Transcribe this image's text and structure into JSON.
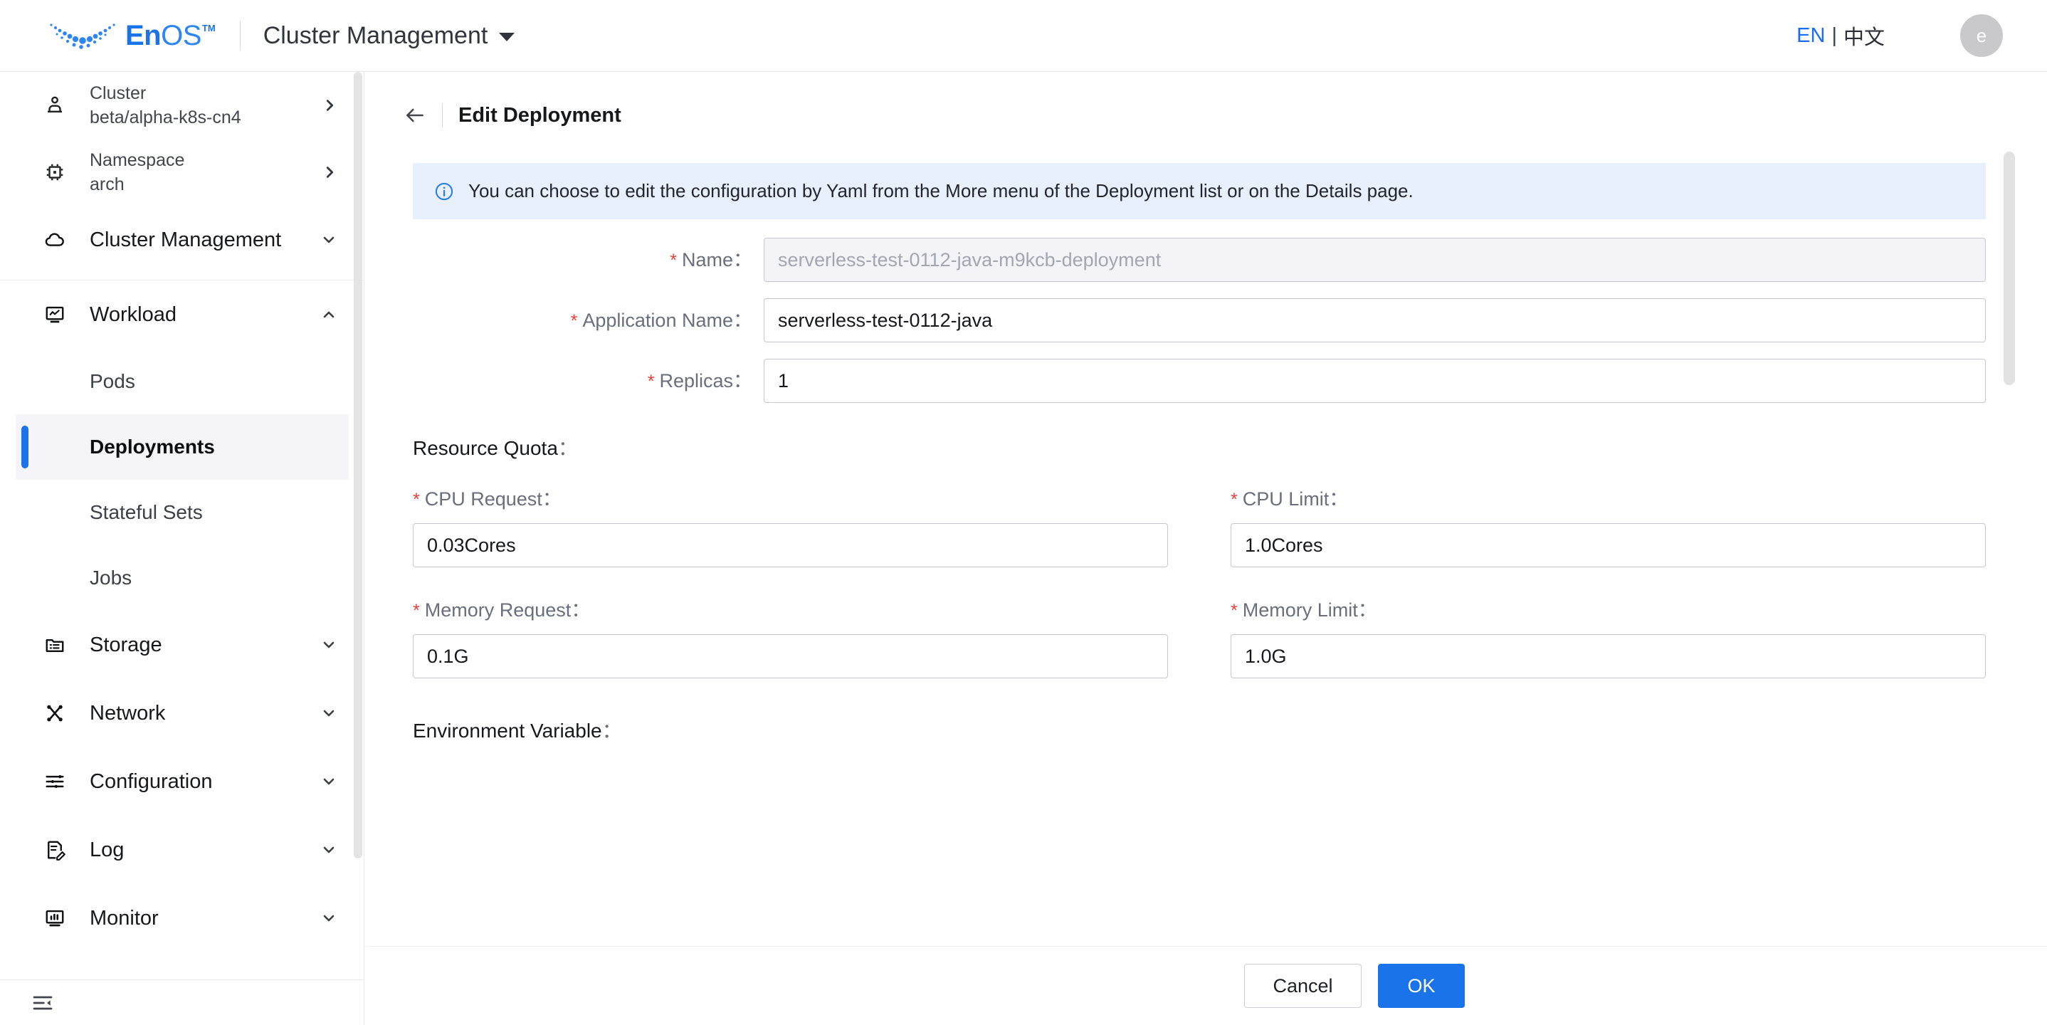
{
  "topbar": {
    "logo_en": "En",
    "logo_os": "OS",
    "logo_tm": "TM",
    "app_title": "Cluster Management",
    "lang_en": "EN",
    "lang_separator": "|",
    "lang_zh": "中文",
    "avatar_initial": "e"
  },
  "sidebar": {
    "context": [
      {
        "label": "Cluster",
        "value": "beta/alpha-k8s-cn4",
        "icon": "user-cluster-icon"
      },
      {
        "label": "Namespace",
        "value": "arch",
        "icon": "namespace-chip-icon"
      }
    ],
    "groups": [
      {
        "label": "Cluster Management",
        "icon": "cloud-icon",
        "state": "collapsed"
      },
      {
        "label": "Workload",
        "icon": "workload-monitor-icon",
        "state": "expanded"
      },
      {
        "label": "Storage",
        "icon": "storage-folder-icon",
        "state": "collapsed"
      },
      {
        "label": "Network",
        "icon": "network-nodes-icon",
        "state": "collapsed"
      },
      {
        "label": "Configuration",
        "icon": "sliders-icon",
        "state": "collapsed"
      },
      {
        "label": "Log",
        "icon": "log-edit-icon",
        "state": "collapsed"
      },
      {
        "label": "Monitor",
        "icon": "monitor-chart-icon",
        "state": "collapsed"
      }
    ],
    "workload_items": [
      {
        "label": "Pods",
        "active": false
      },
      {
        "label": "Deployments",
        "active": true
      },
      {
        "label": "Stateful Sets",
        "active": false
      },
      {
        "label": "Jobs",
        "active": false
      }
    ],
    "collapse_icon": "collapse-sidebar-icon"
  },
  "page": {
    "back_icon": "back-arrow-icon",
    "title": "Edit Deployment",
    "alert_icon": "info-circle-icon",
    "alert_text": "You can choose to edit the configuration by Yaml from the More menu of the Deployment list or on the Details page."
  },
  "form": {
    "name": {
      "label": "Name",
      "required": true,
      "value": "",
      "placeholder": "serverless-test-0112-java-m9kcb-deployment",
      "disabled": true
    },
    "application_name": {
      "label": "Application Name",
      "required": true,
      "value": "serverless-test-0112-java",
      "placeholder": ""
    },
    "replicas": {
      "label": "Replicas",
      "required": true,
      "value": "1",
      "placeholder": ""
    },
    "resource_quota_label": "Resource Quota",
    "quota": [
      {
        "label": "CPU Request",
        "required": true,
        "value": "0.03Cores"
      },
      {
        "label": "CPU Limit",
        "required": true,
        "value": "1.0Cores"
      },
      {
        "label": "Memory Request",
        "required": true,
        "value": "0.1G"
      },
      {
        "label": "Memory Limit",
        "required": true,
        "value": "1.0G"
      }
    ],
    "environment_variable_label": "Environment Variable",
    "colon": "："
  },
  "footer": {
    "cancel_label": "Cancel",
    "ok_label": "OK"
  },
  "colors": {
    "accent_blue": "#1a73e8",
    "required_red": "#e8403a",
    "alert_bg": "#e9f0fd",
    "active_nav_bg": "#f4f4f9",
    "label_gray": "#6a6e7d"
  }
}
